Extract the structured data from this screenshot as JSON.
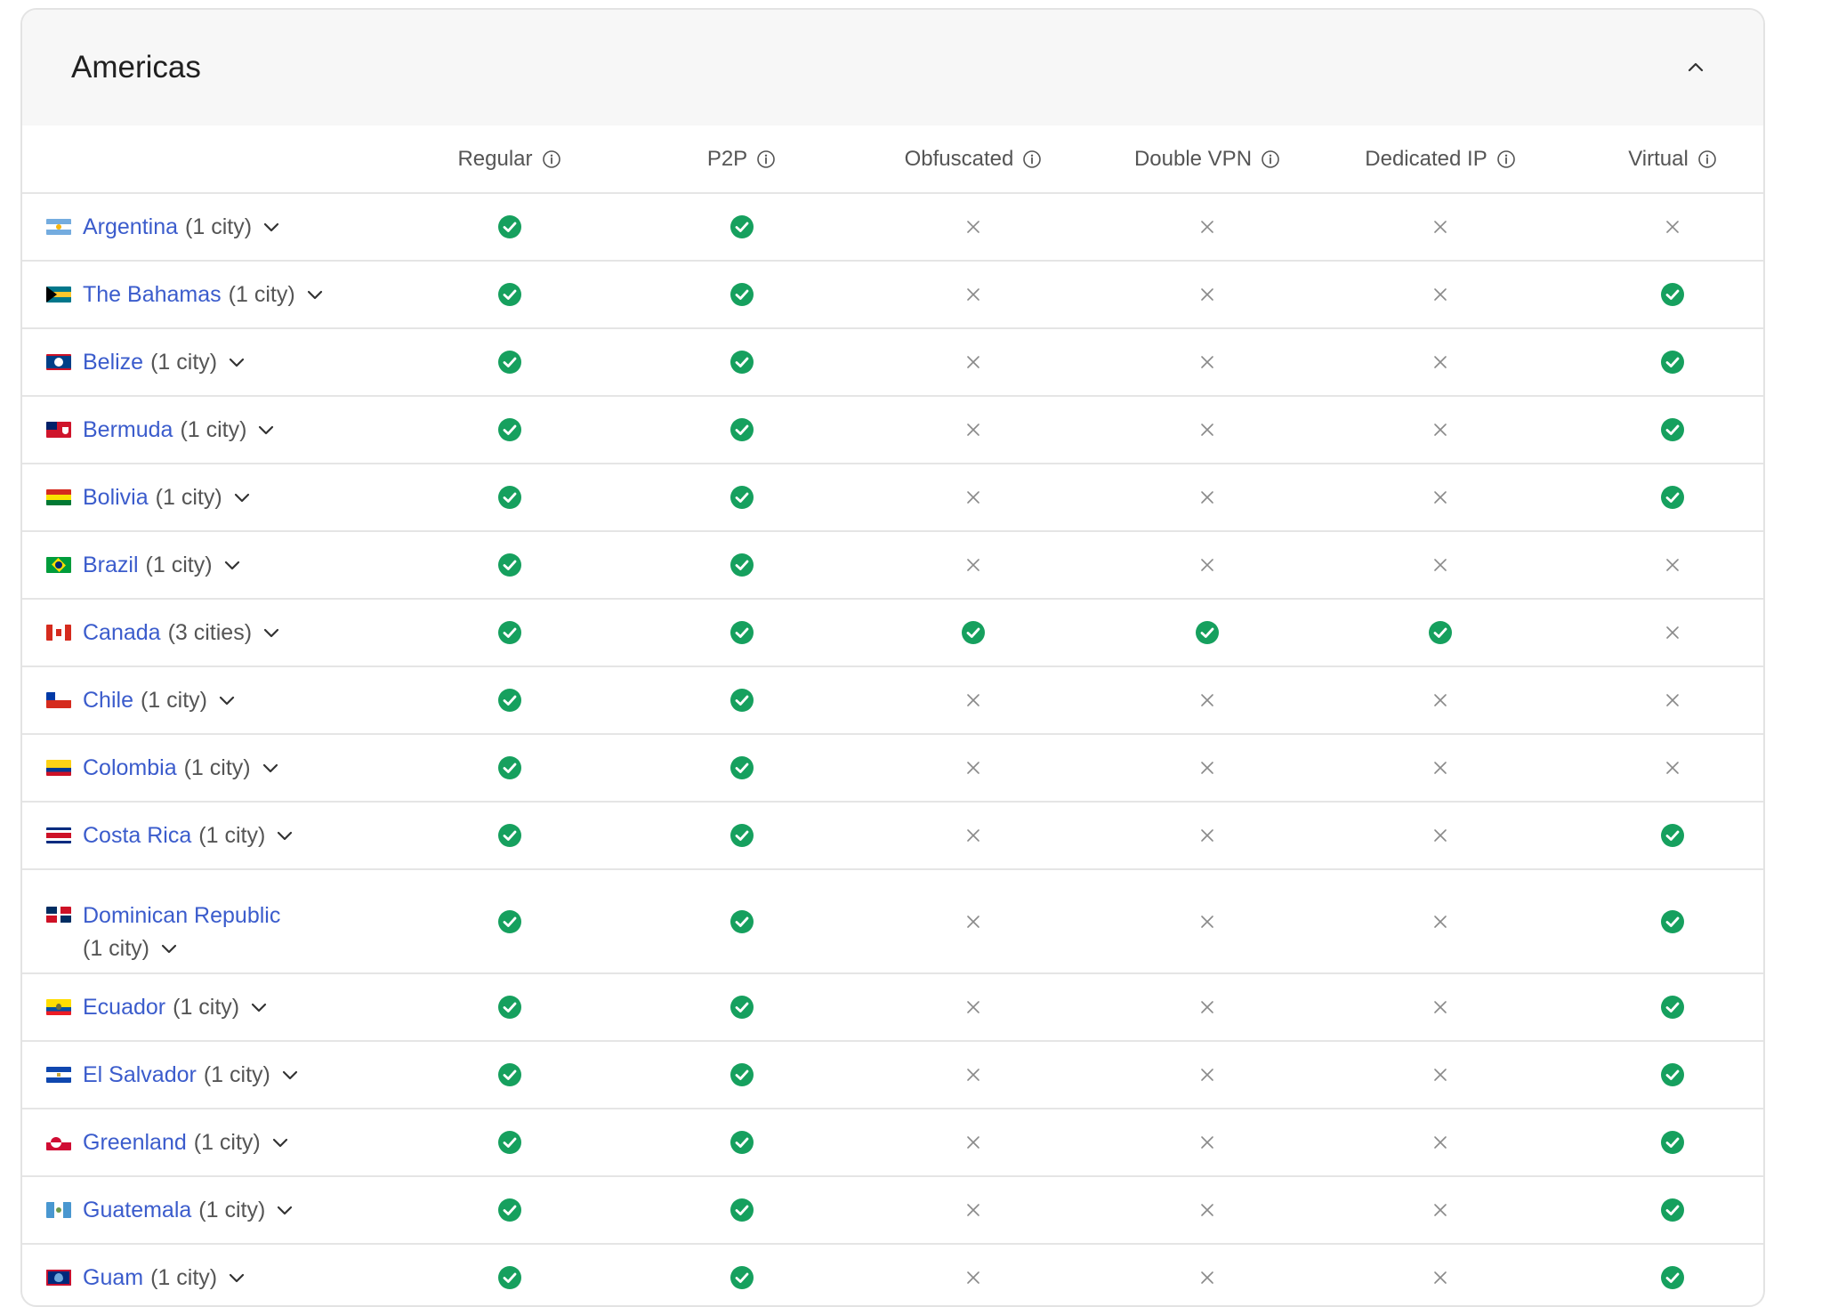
{
  "region": {
    "title": "Americas"
  },
  "colors": {
    "link": "#3b5ccc",
    "check": "#16a05e",
    "cross": "#8a8a8a"
  },
  "columns": [
    {
      "key": "regular",
      "label": "Regular"
    },
    {
      "key": "p2p",
      "label": "P2P"
    },
    {
      "key": "obfuscated",
      "label": "Obfuscated"
    },
    {
      "key": "double_vpn",
      "label": "Double VPN"
    },
    {
      "key": "dedicated_ip",
      "label": "Dedicated IP"
    },
    {
      "key": "virtual",
      "label": "Virtual"
    }
  ],
  "countries": [
    {
      "name": "Argentina",
      "cities": "(1 city)",
      "flag": "argentina",
      "support": [
        true,
        true,
        false,
        false,
        false,
        false
      ]
    },
    {
      "name": "The Bahamas",
      "cities": "(1 city)",
      "flag": "bahamas",
      "support": [
        true,
        true,
        false,
        false,
        false,
        true
      ]
    },
    {
      "name": "Belize",
      "cities": "(1 city)",
      "flag": "belize",
      "support": [
        true,
        true,
        false,
        false,
        false,
        true
      ]
    },
    {
      "name": "Bermuda",
      "cities": "(1 city)",
      "flag": "bermuda",
      "support": [
        true,
        true,
        false,
        false,
        false,
        true
      ]
    },
    {
      "name": "Bolivia",
      "cities": "(1 city)",
      "flag": "bolivia",
      "support": [
        true,
        true,
        false,
        false,
        false,
        true
      ]
    },
    {
      "name": "Brazil",
      "cities": "(1 city)",
      "flag": "brazil",
      "support": [
        true,
        true,
        false,
        false,
        false,
        false
      ]
    },
    {
      "name": "Canada",
      "cities": "(3 cities)",
      "flag": "canada",
      "support": [
        true,
        true,
        true,
        true,
        true,
        false
      ]
    },
    {
      "name": "Chile",
      "cities": "(1 city)",
      "flag": "chile",
      "support": [
        true,
        true,
        false,
        false,
        false,
        false
      ]
    },
    {
      "name": "Colombia",
      "cities": "(1 city)",
      "flag": "colombia",
      "support": [
        true,
        true,
        false,
        false,
        false,
        false
      ]
    },
    {
      "name": "Costa Rica",
      "cities": "(1 city)",
      "flag": "costa-rica",
      "support": [
        true,
        true,
        false,
        false,
        false,
        true
      ]
    },
    {
      "name": "Dominican Republic",
      "cities": "(1 city)",
      "flag": "dominican-republic",
      "wrap": true,
      "support": [
        true,
        true,
        false,
        false,
        false,
        true
      ]
    },
    {
      "name": "Ecuador",
      "cities": "(1 city)",
      "flag": "ecuador",
      "support": [
        true,
        true,
        false,
        false,
        false,
        true
      ]
    },
    {
      "name": "El Salvador",
      "cities": "(1 city)",
      "flag": "el-salvador",
      "support": [
        true,
        true,
        false,
        false,
        false,
        true
      ]
    },
    {
      "name": "Greenland",
      "cities": "(1 city)",
      "flag": "greenland",
      "support": [
        true,
        true,
        false,
        false,
        false,
        true
      ]
    },
    {
      "name": "Guatemala",
      "cities": "(1 city)",
      "flag": "guatemala",
      "support": [
        true,
        true,
        false,
        false,
        false,
        true
      ]
    },
    {
      "name": "Guam",
      "cities": "(1 city)",
      "flag": "guam",
      "support": [
        true,
        true,
        false,
        false,
        false,
        true
      ]
    }
  ]
}
